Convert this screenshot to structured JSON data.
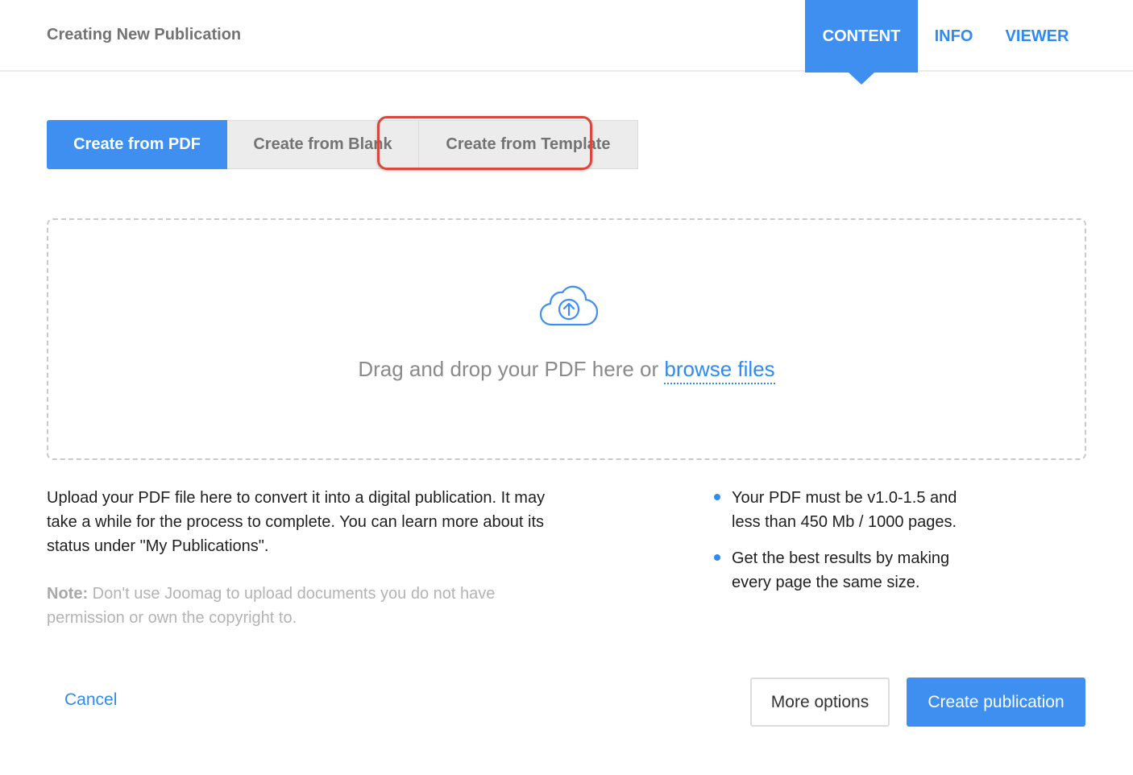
{
  "header": {
    "title": "Creating New Publication",
    "tabs": [
      {
        "label": "CONTENT",
        "active": true
      },
      {
        "label": "INFO",
        "active": false
      },
      {
        "label": "VIEWER",
        "active": false
      }
    ]
  },
  "modes": {
    "pdf": "Create from PDF",
    "blank": "Create from Blank",
    "template": "Create from Template",
    "selected": "Create from PDF"
  },
  "dropzone": {
    "icon": "cloud-upload-icon",
    "text": "Drag and drop your PDF here or ",
    "link": "browse files"
  },
  "info": {
    "description": "Upload your PDF file here to convert it into a digital publication. It may take a while for the process to complete. You can learn more about its status under \"My Publications\".",
    "note_label": "Note:",
    "note_text": " Don't use Joomag to upload documents you do not have permission or own the copyright to."
  },
  "requirements": [
    "Your PDF must be v1.0-1.5 and less than 450 Mb / 1000 pages.",
    "Get the best results by making every page the same size."
  ],
  "footer": {
    "cancel": "Cancel",
    "more_options": "More options",
    "create": "Create publication"
  },
  "colors": {
    "accent": "#3e8ff0",
    "link": "#2f8bef",
    "highlight": "#d9483a"
  }
}
